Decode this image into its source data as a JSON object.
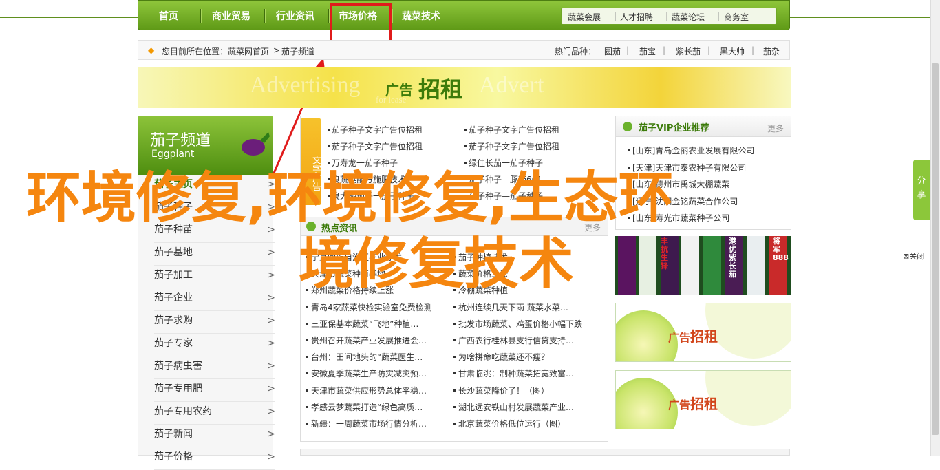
{
  "nav": {
    "items": [
      "首页",
      "商业贸易",
      "行业资讯",
      "市场价格",
      "蔬菜技术"
    ],
    "sub_items": [
      "蔬菜会展",
      "人才招聘",
      "蔬菜论坛",
      "商务室"
    ]
  },
  "breadcrumb": {
    "prefix": "您目前所在位置：",
    "home": "蔬菜网首页",
    "sep": ">",
    "current": "茄子频道",
    "hot_label": "热门品种：",
    "hot": [
      "圆茄",
      "茄宝",
      "紫长茄",
      "黑大帅",
      "茄杂"
    ]
  },
  "ad_banner": {
    "ghost1": "Advertising",
    "ghost2": "Advert",
    "ghost_sub": "for lease",
    "label_small": "广告",
    "label_big": "招租"
  },
  "sidebar": {
    "title": "茄子频道",
    "subtitle": "Eggplant",
    "items": [
      "茄子主页",
      "茄子种子",
      "茄子种苗",
      "茄子基地",
      "茄子加工",
      "茄子企业",
      "茄子求购",
      "茄子专家",
      "茄子病虫害",
      "茄子专用肥",
      "茄子专用农药",
      "茄子新闻",
      "茄子价格"
    ],
    "arrow": ">"
  },
  "section1": {
    "tab_label": "文字广告",
    "left": [
      "茄子种子文字广告位招租",
      "茄子种子文字广告位招租",
      "万寿龙一茄子种子",
      "良蔬菜配方施肥技术",
      "良大棚茄子一茄子种子"
    ],
    "right": [
      "茄子种子文字广告位招租",
      "茄子种子文字广告位招租",
      "绿佳长茄一茄子种子",
      "茄子种子—豚茄601",
      "茄子种子—茄子种子"
    ]
  },
  "section2": {
    "title": "热点资讯",
    "more": "更多",
    "left": [
      "宁夏回族自治区农业厅发",
      "天津市蔬菜种植基地",
      "郑州蔬菜价格持续上涨",
      "青岛4家蔬菜快检实验室免费检测",
      "三亚保基本蔬菜“飞地”种植…",
      "贵州召开蔬菜产业发展推进会…",
      "台州：田间地头的“蔬菜医生…",
      "安徽夏季蔬菜生产防灾减灾预…",
      "天津市蔬菜供应形势总体平稳…",
      "孝感云梦蔬菜打造“绿色高质…",
      "新疆：一周蔬菜市场行情分析…"
    ],
    "right": [
      "茄子种植技术",
      "蔬菜价格上涨",
      "冷棚蔬菜种植",
      "杭州连续几天下雨 蔬菜水菜…",
      "批发市场蔬菜、鸡蛋价格小幅下跌",
      "广西农行桂林县支行信贷支持…",
      "为啥拼命吃蔬菜还不瘦？",
      "甘肃临洮：制种蔬菜拓宽致富…",
      "长沙蔬菜降价了！（图）",
      "湖北远安铁山村发展蔬菜产业…",
      "北京蔬菜价格低位运行（图）"
    ]
  },
  "vip": {
    "title": "茄子VIP企业推荐",
    "more": "更多",
    "items": [
      "[山东]青岛金丽农业发展有限公司",
      "[天津]天津市泰农种子有限公司",
      "[山东]德州市禹城大棚蔬菜",
      "[辽宁]沈阳金铭蔬菜合作公司",
      "[山东]寿光市蔬菜种子公司"
    ]
  },
  "product_photo": {
    "labels": [
      "丰抗生锋",
      "港优紫长茄",
      "将军888"
    ]
  },
  "ad_blocks": [
    {
      "small": "广告",
      "big": "招租"
    },
    {
      "small": "广告",
      "big": "招租"
    }
  ],
  "share": {
    "label": "分享"
  },
  "close_ad": {
    "label": "关闭"
  },
  "overlay": {
    "line1": "环境修复,环境修复,生态环",
    "line2": "境修复技术"
  },
  "colors": {
    "accent": "#5f9a17",
    "overlay": "#f5860f",
    "highlight": "#e01b1b"
  }
}
